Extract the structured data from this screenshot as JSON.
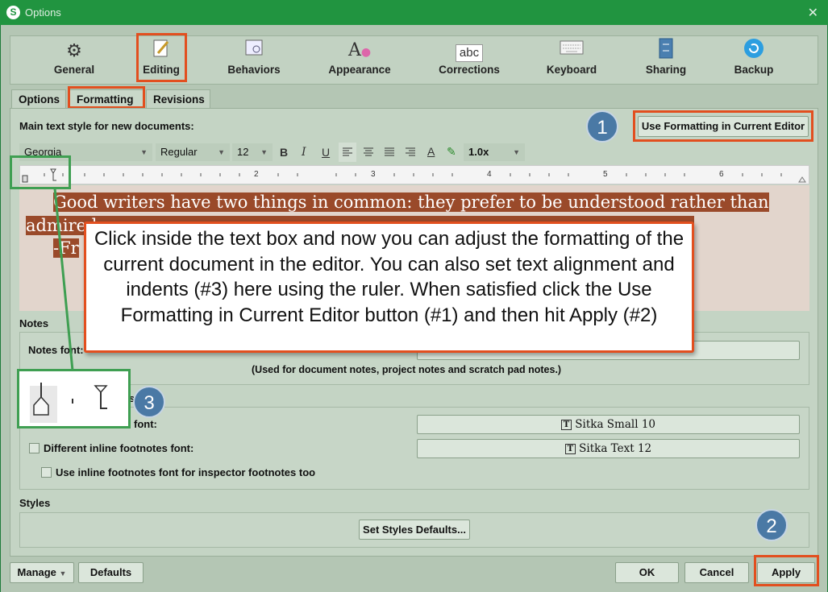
{
  "window": {
    "title": "Options",
    "logo": "S"
  },
  "toolbar": [
    {
      "label": "General",
      "icon": "gears-icon"
    },
    {
      "label": "Editing",
      "icon": "pencil-icon"
    },
    {
      "label": "Behaviors",
      "icon": "window-gear-icon"
    },
    {
      "label": "Appearance",
      "icon": "appearance-icon"
    },
    {
      "label": "Corrections",
      "icon": "abc-icon",
      "icon_text": "abc"
    },
    {
      "label": "Keyboard",
      "icon": "keyboard-icon"
    },
    {
      "label": "Sharing",
      "icon": "sharing-icon"
    },
    {
      "label": "Backup",
      "icon": "backup-icon"
    }
  ],
  "tabs": [
    "Options",
    "Formatting",
    "Revisions"
  ],
  "main_style_label": "Main text style for new documents:",
  "use_formatting_button": "Use Formatting in Current Editor",
  "format_bar": {
    "font": "Georgia",
    "style": "Regular",
    "size": "12",
    "line_spacing": "1.0x",
    "bold": "B",
    "italic": "I",
    "underline": "U",
    "text_color": "A"
  },
  "ruler_numbers": [
    "2",
    "3",
    "4",
    "5",
    "6"
  ],
  "editor_text": {
    "line1": "Good writers have two things in common: they prefer to be understood rather than",
    "line2": "admired",
    "line3": "-Fr"
  },
  "callout": "Click inside the text box and now you can adjust the formatting of the current document in the editor. You can also set text alignment and indents (#3) here using the ruler. When satisfied click the Use Formatting in Current Editor button (#1) and then hit Apply (#2)",
  "notes": {
    "section": "Notes",
    "font_label": "Notes font:",
    "hint": "(Used for document notes, project notes and scratch pad notes.)"
  },
  "footnotes": {
    "font_label": "font:",
    "font_value": "Sitka Small 10",
    "inline_label": "Different inline footnotes font:",
    "inline_value": "Sitka Text 12",
    "inspector_label": "Use inline footnotes font for inspector footnotes too",
    "partial_header": "s"
  },
  "styles": {
    "section": "Styles",
    "button": "Set Styles Defaults..."
  },
  "footer": {
    "manage": "Manage",
    "defaults": "Defaults",
    "ok": "OK",
    "cancel": "Cancel",
    "apply": "Apply"
  },
  "badges": [
    "1",
    "2",
    "3"
  ],
  "colors": {
    "titlebar": "#219440",
    "highlight": "#e24f1f",
    "badge": "#4a79a5",
    "inset_border": "#3f9f52"
  }
}
